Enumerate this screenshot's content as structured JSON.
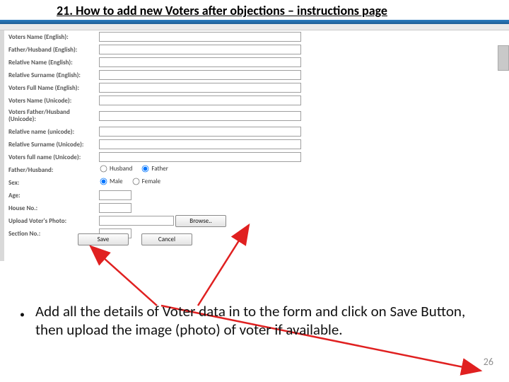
{
  "title": "21.  How to add new Voters after objections – instructions page",
  "form": {
    "labels": {
      "voters_name_en": "Voters Name (English):",
      "father_husband_en": "Father/Husband (English):",
      "relative_name_en": "Relative Name (English):",
      "relative_surname_en": "Relative Surname (English):",
      "voters_full_name_en": "Voters Full Name (English):",
      "voters_name_uni": "Voters Name (Unicode):",
      "voters_father_husband_uni": "Voters Father/Husband (Unicode):",
      "relative_name_uni": "Relative name (unicode):",
      "relative_surname_uni": "Relative Surname (Unicode):",
      "voters_full_name_uni": "Voters full name (Unicode):",
      "father_husband": "Father/Husband:",
      "sex": "Sex:",
      "age": "Age:",
      "house_no": "House No.:",
      "upload_photo": "Upload Voter's Photo:",
      "section_no": "Section No.:"
    },
    "radios": {
      "husband": "Husband",
      "father": "Father",
      "male": "Male",
      "female": "Female"
    },
    "buttons": {
      "browse": "Browse..",
      "save": "Save",
      "cancel": "Cancel"
    }
  },
  "instruction": "Add all the details of Voter data in to the form and click on Save Button, then upload the image (photo) of voter if available.",
  "page_number": "26"
}
